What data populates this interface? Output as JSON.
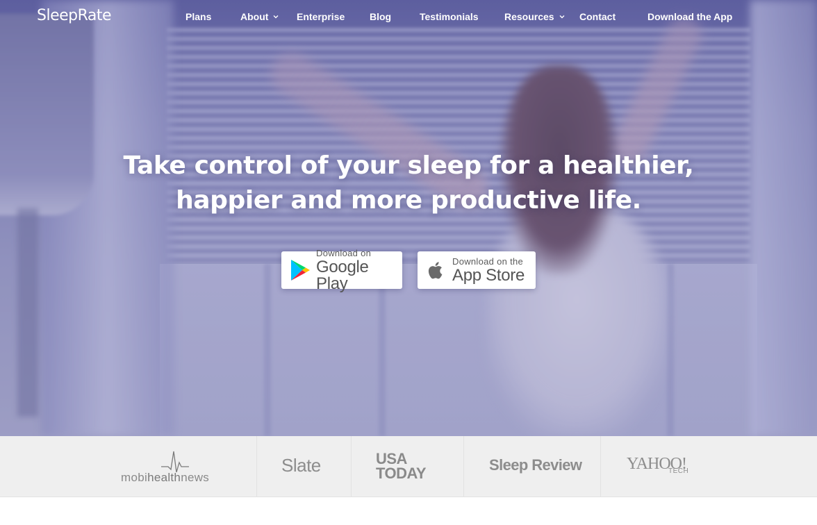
{
  "brand": {
    "logo_text": "SleepRate"
  },
  "nav": {
    "items": [
      {
        "label": "Plans",
        "has_dropdown": false
      },
      {
        "label": "About",
        "has_dropdown": true
      },
      {
        "label": "Enterprise",
        "has_dropdown": false
      },
      {
        "label": "Blog",
        "has_dropdown": false
      },
      {
        "label": "Testimonials",
        "has_dropdown": false
      },
      {
        "label": "Resources",
        "has_dropdown": true
      },
      {
        "label": "Contact",
        "has_dropdown": false
      },
      {
        "label": "Download the App",
        "has_dropdown": false
      }
    ]
  },
  "hero": {
    "headline_line1": "Take control of your sleep for a healthier,",
    "headline_line2": "happier and more productive life."
  },
  "store_buttons": {
    "google": {
      "small": "Download on",
      "big": "Google Play",
      "icon": "google-play-icon"
    },
    "apple": {
      "small": "Download on the",
      "big": "App Store",
      "icon": "apple-icon"
    }
  },
  "press": {
    "mobihealthnews": {
      "part1": "mobi",
      "part2": "health",
      "part3": "news"
    },
    "slate": "Slate",
    "usa_today_line1": "USA",
    "usa_today_line2": "TODAY",
    "sleep_review": "Sleep Review",
    "yahoo": "YAHOO!",
    "yahoo_sub": "TECH"
  },
  "colors": {
    "hero_tint": "#5c5ea0",
    "nav_text": "#ffffff",
    "press_bg": "#efefef",
    "press_logo": "#8d8d8d"
  }
}
